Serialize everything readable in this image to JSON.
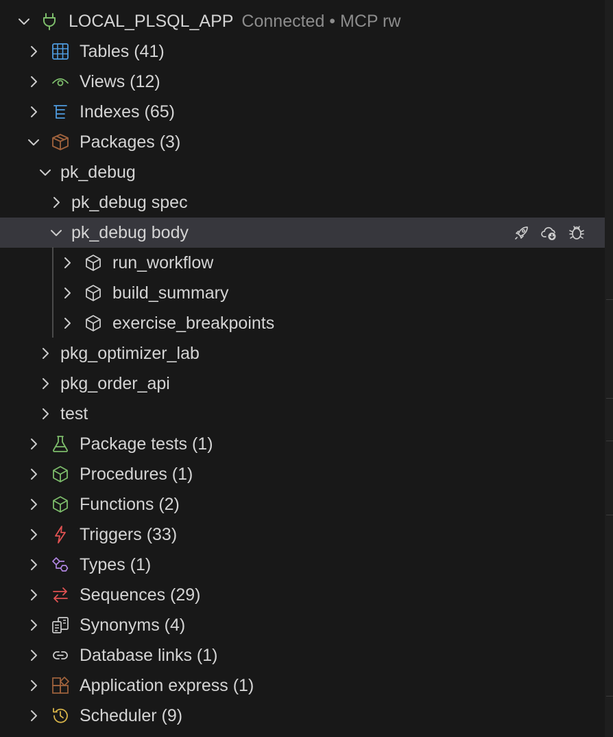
{
  "connection": {
    "name": "LOCAL_PLSQL_APP",
    "status": "Connected • MCP rw"
  },
  "nodes": {
    "tables": "Tables (41)",
    "views": "Views (12)",
    "indexes": "Indexes (65)",
    "packages": "Packages (3)",
    "pk_debug": "pk_debug",
    "pk_debug_spec": "pk_debug spec",
    "pk_debug_body": "pk_debug body",
    "run_workflow": "run_workflow",
    "build_summary": "build_summary",
    "exercise_breakpoints": "exercise_breakpoints",
    "pkg_optimizer_lab": "pkg_optimizer_lab",
    "pkg_order_api": "pkg_order_api",
    "test": "test",
    "package_tests": "Package tests (1)",
    "procedures": "Procedures (1)",
    "functions": "Functions (2)",
    "triggers": "Triggers (33)",
    "types": "Types (1)",
    "sequences": "Sequences (29)",
    "synonyms": "Synonyms (4)",
    "database_links": "Database links (1)",
    "application_express": "Application express (1)",
    "scheduler": "Scheduler (9)"
  },
  "icons": {
    "connection": "plug-icon",
    "tables": "table-grid-icon",
    "views": "eye-icon",
    "indexes": "index-list-icon",
    "packages": "package-box-icon",
    "methods": "cube-icon",
    "package_tests": "flask-icon",
    "procedures": "cube-icon",
    "functions": "cube-icon",
    "triggers": "lightning-icon",
    "types": "type-shapes-icon",
    "sequences": "arrows-exchange-icon",
    "synonyms": "copy-docs-icon",
    "database_links": "link-icon",
    "application_express": "apex-blocks-icon",
    "scheduler": "history-clock-icon",
    "row_actions": [
      "rocket-icon",
      "cloud-download-icon",
      "debug-bug-icon"
    ]
  },
  "colors": {
    "background": "#181818",
    "selected_row": "#37373d",
    "text": "#d4d4d4",
    "status_text": "#8c8c8c",
    "green": "#7dbd6b",
    "blue": "#4f9ce0",
    "brown": "#a1633d",
    "red": "#e05252",
    "purple": "#b085e0",
    "yellow": "#d7b449"
  }
}
